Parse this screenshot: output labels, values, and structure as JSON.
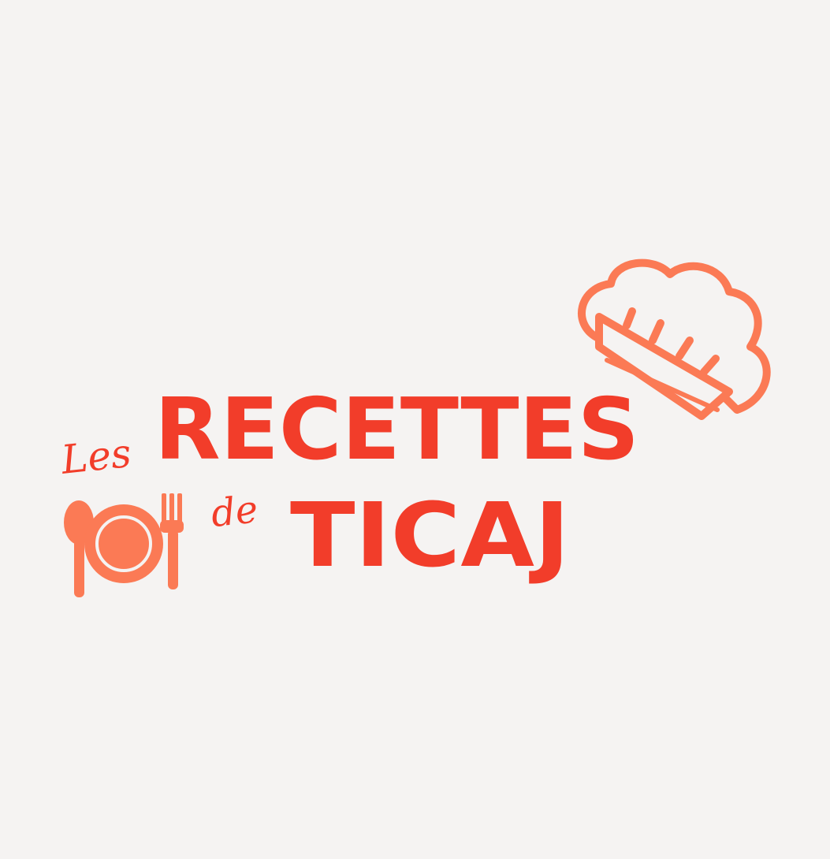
{
  "brand": {
    "word_les": "Les",
    "word_recettes": "RECETTES",
    "word_de": "de",
    "word_ticaj": "TICAJ"
  },
  "colors": {
    "background": "#f5f3f2",
    "text_red": "#f23d2a",
    "icon_orange": "#fb7a55",
    "hat_orange": "#fb7a55"
  },
  "icons": {
    "hat": "chef-hat-icon",
    "plate": "plate-icon",
    "spoon": "spoon-icon",
    "fork": "fork-icon"
  }
}
